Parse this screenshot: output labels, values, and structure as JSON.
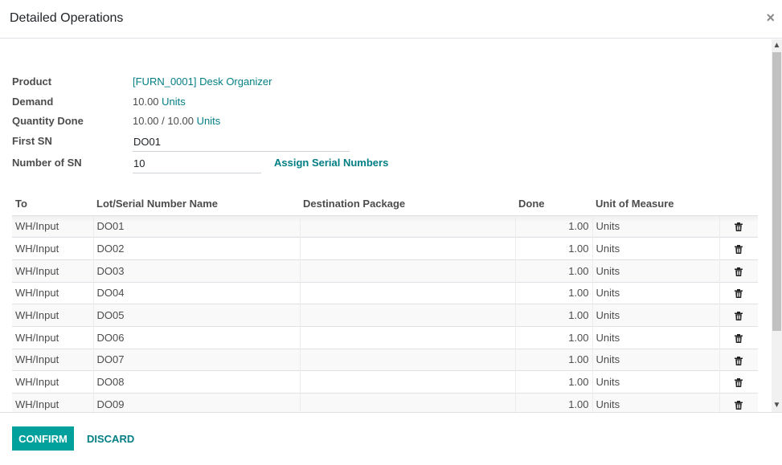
{
  "dialog": {
    "title": "Detailed Operations",
    "close_icon": "close-icon ×"
  },
  "form": {
    "product": {
      "label": "Product",
      "value": "[FURN_0001] Desk Organizer"
    },
    "demand": {
      "label": "Demand",
      "qty": "10.00",
      "uom": "Units"
    },
    "quantity_done": {
      "label": "Quantity Done",
      "done": "10.00",
      "separator": "/",
      "total": "10.00",
      "uom": "Units"
    },
    "first_sn": {
      "label": "First SN",
      "value": "DO01"
    },
    "number_of_sn": {
      "label": "Number of SN",
      "value": "10"
    },
    "assign_button": "Assign Serial Numbers"
  },
  "table": {
    "columns": [
      "To",
      "Lot/Serial Number Name",
      "Destination Package",
      "Done",
      "Unit of Measure"
    ],
    "rows": [
      {
        "to": "WH/Input",
        "lot": "DO01",
        "package": "",
        "done": "1.00",
        "uom": "Units"
      },
      {
        "to": "WH/Input",
        "lot": "DO02",
        "package": "",
        "done": "1.00",
        "uom": "Units"
      },
      {
        "to": "WH/Input",
        "lot": "DO03",
        "package": "",
        "done": "1.00",
        "uom": "Units"
      },
      {
        "to": "WH/Input",
        "lot": "DO04",
        "package": "",
        "done": "1.00",
        "uom": "Units"
      },
      {
        "to": "WH/Input",
        "lot": "DO05",
        "package": "",
        "done": "1.00",
        "uom": "Units"
      },
      {
        "to": "WH/Input",
        "lot": "DO06",
        "package": "",
        "done": "1.00",
        "uom": "Units"
      },
      {
        "to": "WH/Input",
        "lot": "DO07",
        "package": "",
        "done": "1.00",
        "uom": "Units"
      },
      {
        "to": "WH/Input",
        "lot": "DO08",
        "package": "",
        "done": "1.00",
        "uom": "Units"
      },
      {
        "to": "WH/Input",
        "lot": "DO09",
        "package": "",
        "done": "1.00",
        "uom": "Units"
      }
    ]
  },
  "footer": {
    "confirm_label": "CONFIRM",
    "discard_label": "DISCARD"
  },
  "colors": {
    "primary": "#00a09d",
    "link": "#017e84"
  }
}
